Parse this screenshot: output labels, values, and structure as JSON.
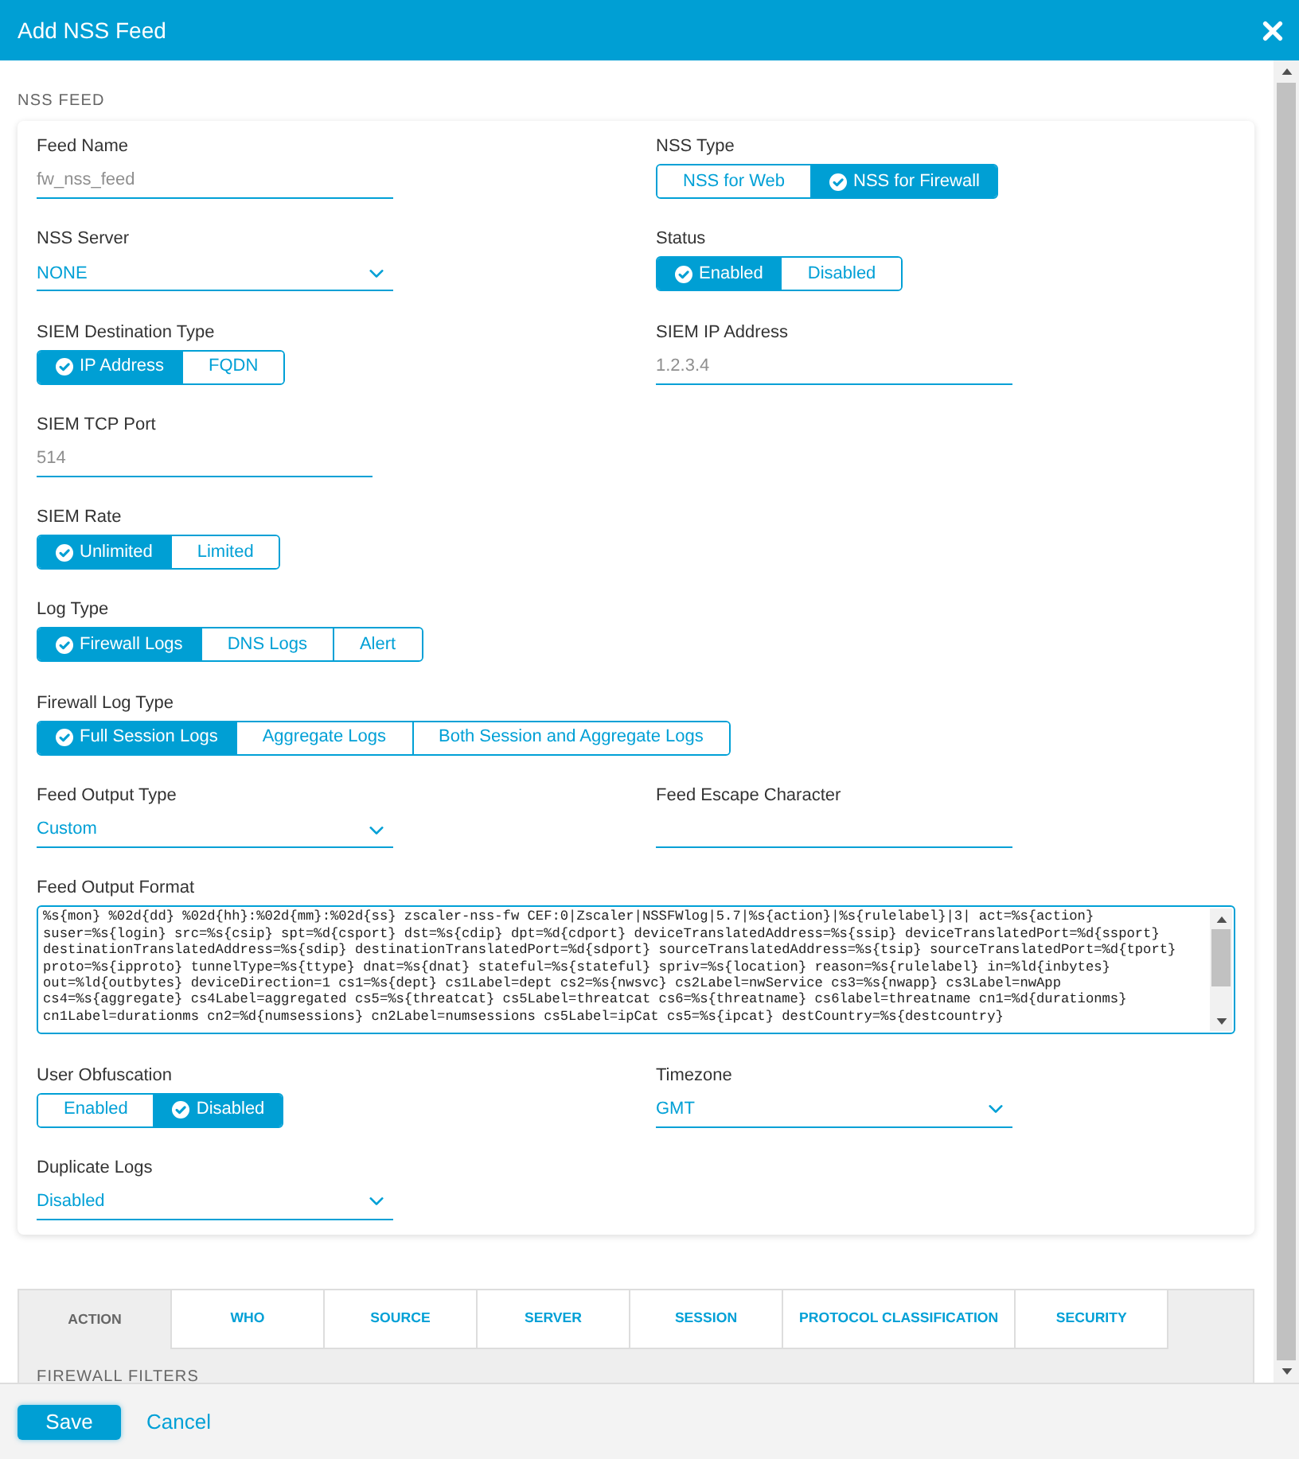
{
  "window": {
    "title": "Add NSS Feed"
  },
  "section": {
    "title": "NSS FEED"
  },
  "form_rows": [
    [
      {
        "kind": "text",
        "label": "Feed Name",
        "value": "fw_nss_feed"
      },
      {
        "kind": "segmented",
        "label": "NSS Type",
        "options": [
          {
            "label": "NSS for Web",
            "selected": false
          },
          {
            "label": "NSS for Firewall",
            "selected": true
          }
        ]
      }
    ],
    [
      {
        "kind": "select",
        "label": "NSS Server",
        "value": "NONE"
      },
      {
        "kind": "segmented",
        "label": "Status",
        "options": [
          {
            "label": "Enabled",
            "selected": true
          },
          {
            "label": "Disabled",
            "selected": false
          }
        ]
      }
    ],
    [
      {
        "kind": "segmented",
        "label": "SIEM Destination Type",
        "options": [
          {
            "label": "IP Address",
            "selected": true
          },
          {
            "label": "FQDN",
            "selected": false
          }
        ]
      },
      {
        "kind": "text",
        "label": "SIEM IP Address",
        "value": "1.2.3.4"
      }
    ],
    [
      {
        "kind": "number",
        "label": "SIEM TCP Port",
        "value": "514"
      }
    ],
    [
      {
        "kind": "segmented",
        "label": "SIEM Rate",
        "options": [
          {
            "label": "Unlimited",
            "selected": true
          },
          {
            "label": "Limited",
            "selected": false
          }
        ]
      }
    ],
    [
      {
        "kind": "segmented",
        "label": "Log Type",
        "options": [
          {
            "label": "Firewall Logs",
            "selected": true
          },
          {
            "label": "DNS Logs",
            "selected": false
          },
          {
            "label": "Alert",
            "selected": false
          }
        ]
      }
    ],
    [
      {
        "kind": "segmented",
        "label": "Firewall Log Type",
        "options": [
          {
            "label": "Full Session Logs",
            "selected": true
          },
          {
            "label": "Aggregate Logs",
            "selected": false
          },
          {
            "label": "Both Session and Aggregate Logs",
            "selected": false
          }
        ]
      }
    ],
    [
      {
        "kind": "select",
        "label": "Feed Output Type",
        "value": "Custom"
      },
      {
        "kind": "text",
        "label": "Feed Escape Character"
      }
    ],
    [
      {
        "kind": "textarea",
        "label": "Feed Output Format",
        "value": "%s{mon} %02d{dd} %02d{hh}:%02d{mm}:%02d{ss} zscaler-nss-fw CEF:0|Zscaler|NSSFWlog|5.7|%s{action}|%s{rulelabel}|3| act=%s{action} suser=%s{login} src=%s{csip} spt=%d{csport} dst=%s{cdip} dpt=%d{cdport} deviceTranslatedAddress=%s{ssip} deviceTranslatedPort=%d{ssport} destinationTranslatedAddress=%s{sdip} destinationTranslatedPort=%d{sdport} sourceTranslatedAddress=%s{tsip} sourceTranslatedPort=%d{tport} proto=%s{ipproto} tunnelType=%s{ttype} dnat=%s{dnat} stateful=%s{stateful} spriv=%s{location} reason=%s{rulelabel} in=%ld{inbytes} out=%ld{outbytes} deviceDirection=1 cs1=%s{dept} cs1Label=dept cs2=%s{nwsvc} cs2Label=nwService cs3=%s{nwapp} cs3Label=nwApp cs4=%s{aggregate} cs4Label=aggregated cs5=%s{threatcat} cs5Label=threatcat cs6=%s{threatname} cs6label=threatname cn1=%d{durationms} cn1Label=durationms cn2=%d{numsessions} cn2Label=numsessions cs5Label=ipCat cs5=%s{ipcat} destCountry=%s{destcountry}"
      }
    ],
    [
      {
        "kind": "segmented",
        "label": "User Obfuscation",
        "options": [
          {
            "label": "Enabled",
            "selected": false
          },
          {
            "label": "Disabled",
            "selected": true
          }
        ]
      },
      {
        "kind": "select",
        "label": "Timezone",
        "value": "GMT"
      }
    ],
    [
      {
        "kind": "select",
        "label": "Duplicate Logs",
        "value": "Disabled"
      }
    ]
  ],
  "filter_tabs": [
    {
      "label": "ACTION",
      "selected": true
    },
    {
      "label": "WHO",
      "selected": false
    },
    {
      "label": "SOURCE",
      "selected": false
    },
    {
      "label": "SERVER",
      "selected": false
    },
    {
      "label": "SESSION",
      "selected": false
    },
    {
      "label": "PROTOCOL CLASSIFICATION",
      "selected": false
    },
    {
      "label": "SECURITY",
      "selected": false
    }
  ],
  "filters_section": {
    "title": "FIREWALL FILTERS"
  },
  "footer": {
    "buttons": [
      {
        "kind": "primary",
        "label": "Save"
      },
      {
        "kind": "link",
        "label": "Cancel"
      }
    ]
  }
}
